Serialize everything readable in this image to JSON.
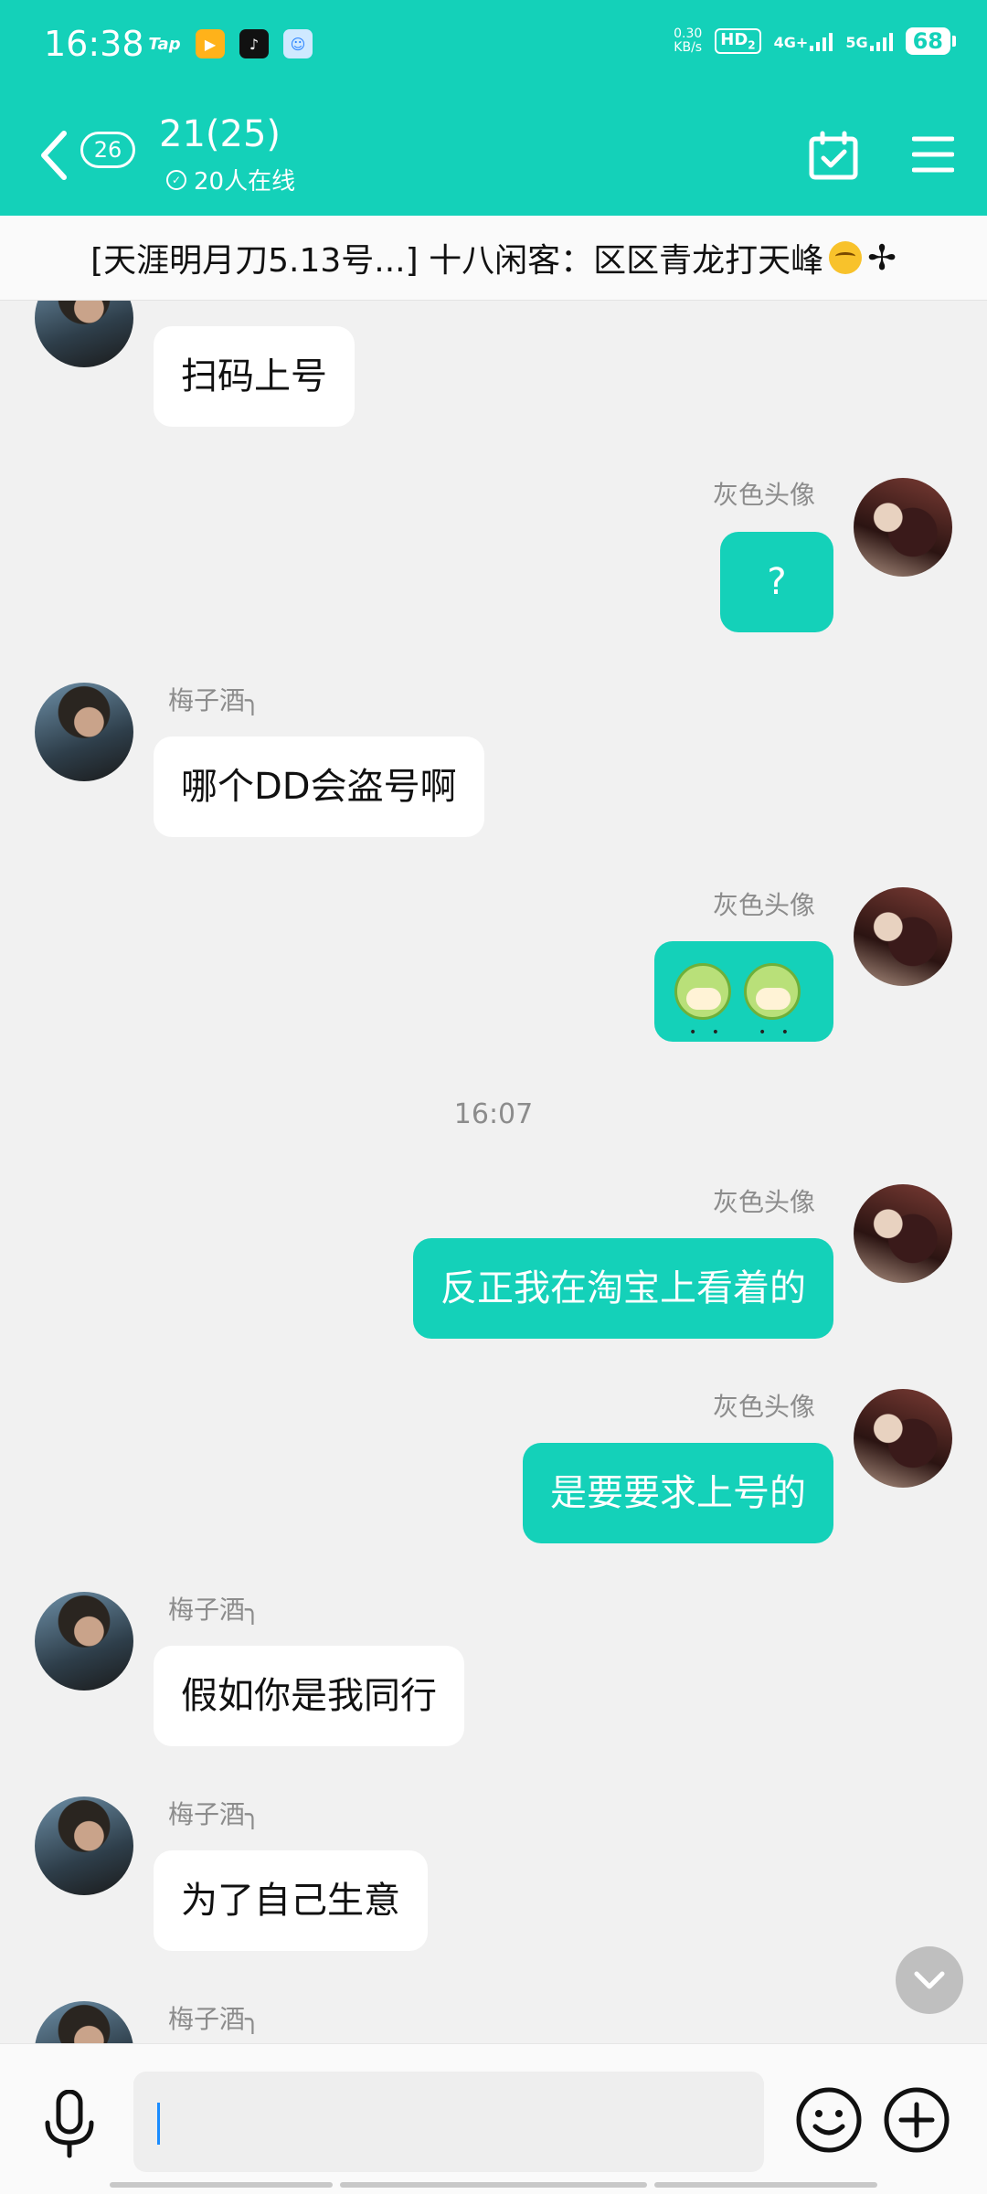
{
  "status_bar": {
    "time": "16:38",
    "apps": [
      "Tap",
      "game-app",
      "tiktok-app",
      "qq-app"
    ],
    "net_speed_value": "0.30",
    "net_speed_unit": "KB/s",
    "hd": "HD",
    "hd_sub": "2",
    "signal_1": "4G+",
    "signal_2": "5G",
    "battery": "68"
  },
  "header": {
    "unread_count": "26",
    "title": "21(25)",
    "online_text": "20人在线",
    "accent": "#14d1b9"
  },
  "announcement": {
    "text": "[天涯明月刀5.13号...] 十八闲客：区区青龙打天峰"
  },
  "chat": {
    "messages": [
      {
        "side": "left",
        "sender": "梅子酒╮",
        "text": "扫码上号"
      },
      {
        "side": "right",
        "sender": "灰色头像",
        "text": "?"
      },
      {
        "side": "left",
        "sender": "梅子酒╮",
        "text": "哪个DD会盗号啊"
      },
      {
        "side": "right",
        "sender": "灰色头像",
        "text": ""
      },
      {
        "side": "right",
        "sender": "灰色头像",
        "text": "反正我在淘宝上看着的"
      },
      {
        "side": "right",
        "sender": "灰色头像",
        "text": "是要要求上号的"
      },
      {
        "side": "left",
        "sender": "梅子酒╮",
        "text": "假如你是我同行"
      },
      {
        "side": "left",
        "sender": "梅子酒╮",
        "text": "为了自己生意"
      },
      {
        "side": "left",
        "sender": "梅子酒╮",
        "text": ""
      }
    ],
    "timestamp": "16:07"
  },
  "input": {
    "placeholder": ""
  }
}
